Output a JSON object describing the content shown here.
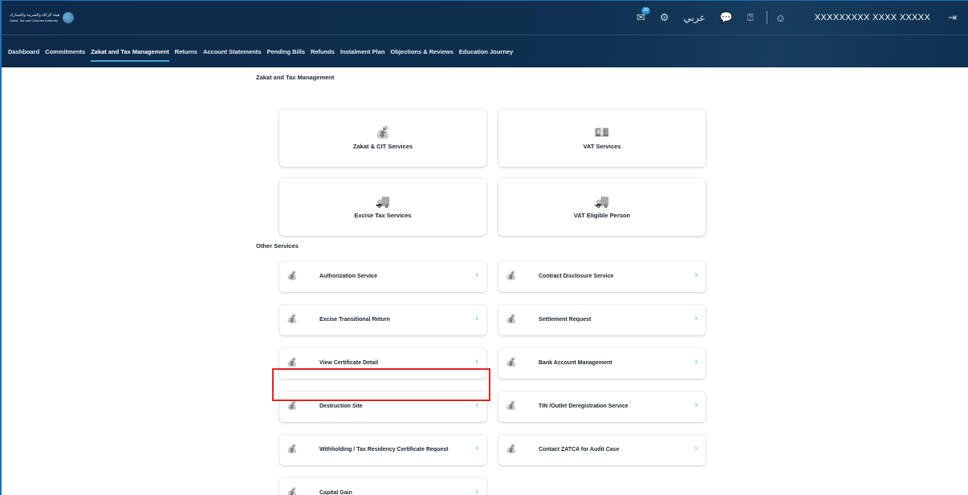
{
  "header": {
    "logo_ar": "هيئة الزكاة والضريبة والجمارك",
    "logo_en": "Zakat, Tax and Customs Authority",
    "notification_count": "39",
    "language_label": "عربي",
    "username": "XXXXXXXXX XXXX XXXXX"
  },
  "nav": [
    {
      "label": "Dashboard"
    },
    {
      "label": "Commitments"
    },
    {
      "label": "Zakat and Tax Management",
      "active": true
    },
    {
      "label": "Returns"
    },
    {
      "label": "Account Statements"
    },
    {
      "label": "Pending Bills"
    },
    {
      "label": "Refunds"
    },
    {
      "label": "Instalment Plan"
    },
    {
      "label": "Objections & Reviews"
    },
    {
      "label": "Education Journey"
    }
  ],
  "main": {
    "page_title": "Zakat and Tax Management",
    "main_services": [
      {
        "label": "Zakat & CIT Services",
        "icon": "money-hand-icon",
        "glyph": "💰"
      },
      {
        "label": "VAT Services",
        "icon": "money-stack-icon",
        "glyph": "💵"
      },
      {
        "label": "Excise Tax Services",
        "icon": "truck-icon",
        "glyph": "🚚"
      },
      {
        "label": "VAT Eligible Person",
        "icon": "truck-icon",
        "glyph": "🚚"
      }
    ],
    "other_title": "Other Services",
    "other_services": [
      {
        "label": "Authorization Service"
      },
      {
        "label": "Contract Disclosure Service"
      },
      {
        "label": "Excise Transitional Return"
      },
      {
        "label": "Settlement Request"
      },
      {
        "label": "View Certificate Detail"
      },
      {
        "label": "Bank Account Management"
      },
      {
        "label": "Destruction Site"
      },
      {
        "label": "TIN /Outlet Deregistration Service"
      },
      {
        "label": "Withholding / Tax Residency Certificate Request",
        "highlighted": true
      },
      {
        "label": "Contact ZATCA for Audit Case"
      },
      {
        "label": "Capital Gain"
      }
    ]
  },
  "colors": {
    "header_bg": "#0f3050",
    "accent": "#4aa3df",
    "chevron": "#54c0c4",
    "highlight": "#e02424"
  }
}
